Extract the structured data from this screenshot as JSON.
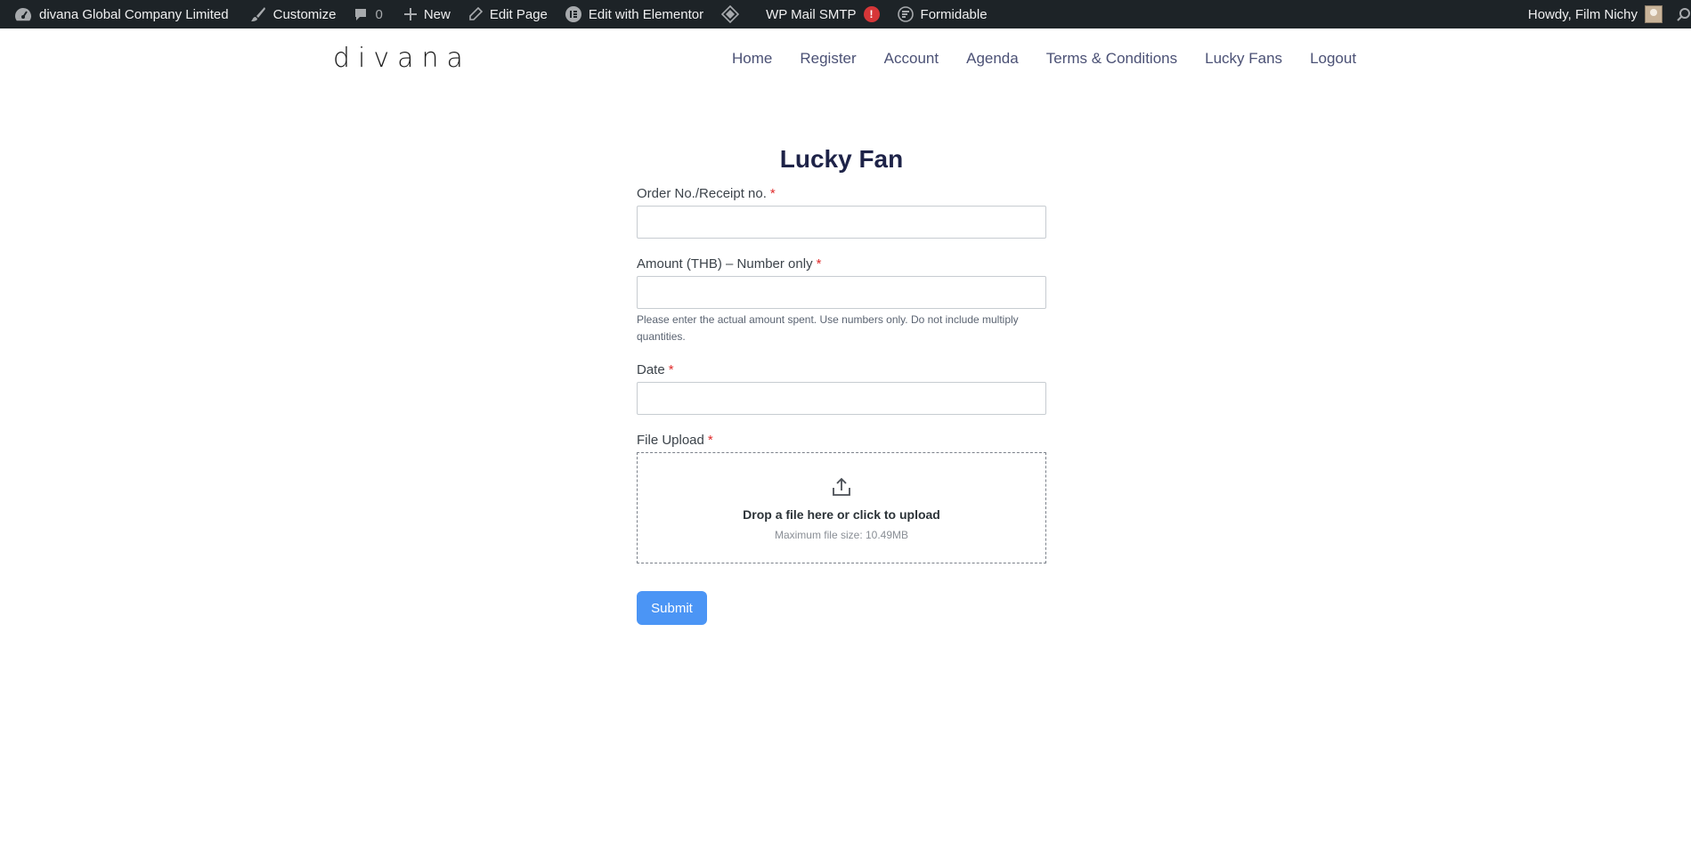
{
  "adminbar": {
    "site_name": "divana Global Company Limited",
    "customize": "Customize",
    "comments_count": "0",
    "new": "New",
    "edit_page": "Edit Page",
    "edit_elementor": "Edit with Elementor",
    "wp_mail_smtp": "WP Mail SMTP",
    "smtp_badge": "!",
    "formidable": "Formidable",
    "howdy": "Howdy, Film Nichy"
  },
  "header": {
    "logo": "divana",
    "nav": [
      "Home",
      "Register",
      "Account",
      "Agenda",
      "Terms & Conditions",
      "Lucky Fans",
      "Logout"
    ]
  },
  "form": {
    "title": "Lucky Fan",
    "fields": [
      {
        "label": "Order No./Receipt no.",
        "required_mark": "*",
        "value": "",
        "help": ""
      },
      {
        "label": "Amount (THB) – Number only",
        "required_mark": "*",
        "value": "",
        "help": "Please enter the actual amount spent. Use numbers only. Do not include multiply quantities."
      },
      {
        "label": "Date",
        "required_mark": "*",
        "value": "",
        "help": ""
      }
    ],
    "upload": {
      "label": "File Upload",
      "required_mark": "*",
      "prompt": "Drop a file here or click to upload",
      "max_size": "Maximum file size: 10.49MB"
    },
    "submit": "Submit"
  },
  "colors": {
    "adminbar_bg": "#1d2327",
    "required": "#e02b2b",
    "submit_bg": "#4b95f5",
    "title": "#1e2348"
  }
}
